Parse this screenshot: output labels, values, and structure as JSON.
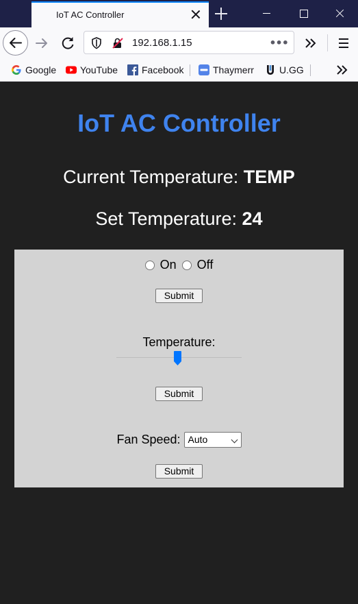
{
  "browser": {
    "tab_title": "IoT AC Controller",
    "url": "192.168.1.15",
    "url_more": "•••",
    "bookmarks": [
      {
        "label": "Google",
        "icon": "google-icon"
      },
      {
        "label": "YouTube",
        "icon": "youtube-icon"
      },
      {
        "label": "Facebook",
        "icon": "facebook-icon"
      },
      {
        "label": "Thaymerr",
        "icon": "opgg-icon"
      },
      {
        "label": "U.GG",
        "icon": "ugg-icon"
      }
    ]
  },
  "page": {
    "title": "IoT AC Controller",
    "current_temp_label": "Current Temperature: ",
    "current_temp_value": "TEMP",
    "set_temp_label": "Set Temperature: ",
    "set_temp_value": "24",
    "power": {
      "options": [
        "On",
        "Off"
      ],
      "submit_label": "Submit"
    },
    "temperature": {
      "label": "Temperature:",
      "slider_value_fraction": 0.49,
      "submit_label": "Submit"
    },
    "fan": {
      "label": "Fan Speed:",
      "selected": "Auto",
      "submit_label": "Submit"
    }
  },
  "colors": {
    "page_bg": "#202020",
    "title": "#3f83ee",
    "panel_bg": "#d3d3d3",
    "tabstrip": "#1e2147",
    "tab_accent": "#0a84ff",
    "slider_thumb": "#0075ff"
  }
}
